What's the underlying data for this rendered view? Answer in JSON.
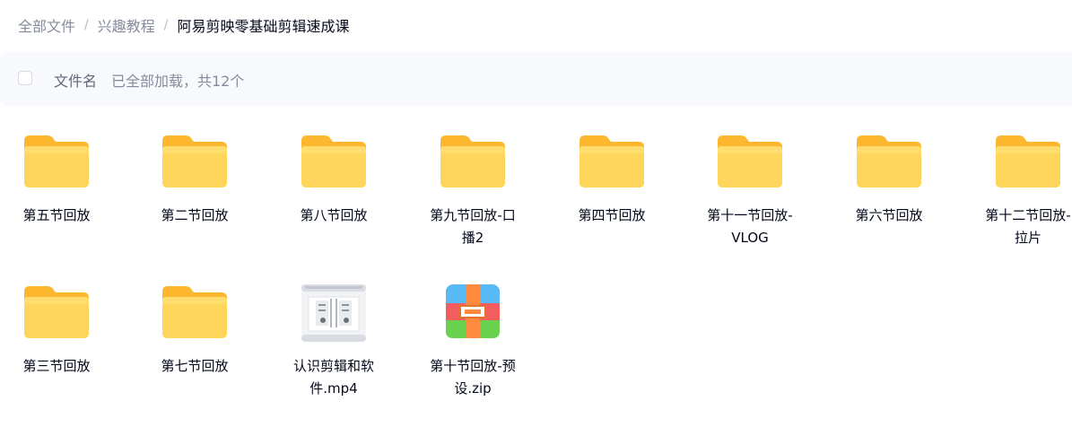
{
  "breadcrumb": {
    "items": [
      "全部文件",
      "兴趣教程",
      "阿易剪映零基础剪辑速成课"
    ],
    "separator": "/"
  },
  "list_header": {
    "name_label": "文件名",
    "status_text": "已全部加载，共12个"
  },
  "files": [
    {
      "name": "第五节回放",
      "type": "folder-icon"
    },
    {
      "name": "第二节回放",
      "type": "folder-icon"
    },
    {
      "name": "第八节回放",
      "type": "folder-icon"
    },
    {
      "name": "第九节回放-口播2",
      "type": "folder-icon"
    },
    {
      "name": "第四节回放",
      "type": "folder-icon"
    },
    {
      "name": "第十一节回放-VLOG",
      "type": "folder-icon"
    },
    {
      "name": "第六节回放",
      "type": "folder-icon"
    },
    {
      "name": "第十二节回放-拉片",
      "type": "folder-icon"
    },
    {
      "name": "第三节回放",
      "type": "folder-icon"
    },
    {
      "name": "第七节回放",
      "type": "folder-icon"
    },
    {
      "name": "认识剪辑和软件.mp4",
      "type": "video-thumbnail-icon"
    },
    {
      "name": "第十节回放-预设.zip",
      "type": "zip-archive-icon"
    }
  ],
  "colors": {
    "folder_back": "#fdb72f",
    "folder_front": "#ffd65c",
    "text": "#03081a",
    "muted": "#878c9c",
    "header_bg": "#f7f9fc"
  }
}
